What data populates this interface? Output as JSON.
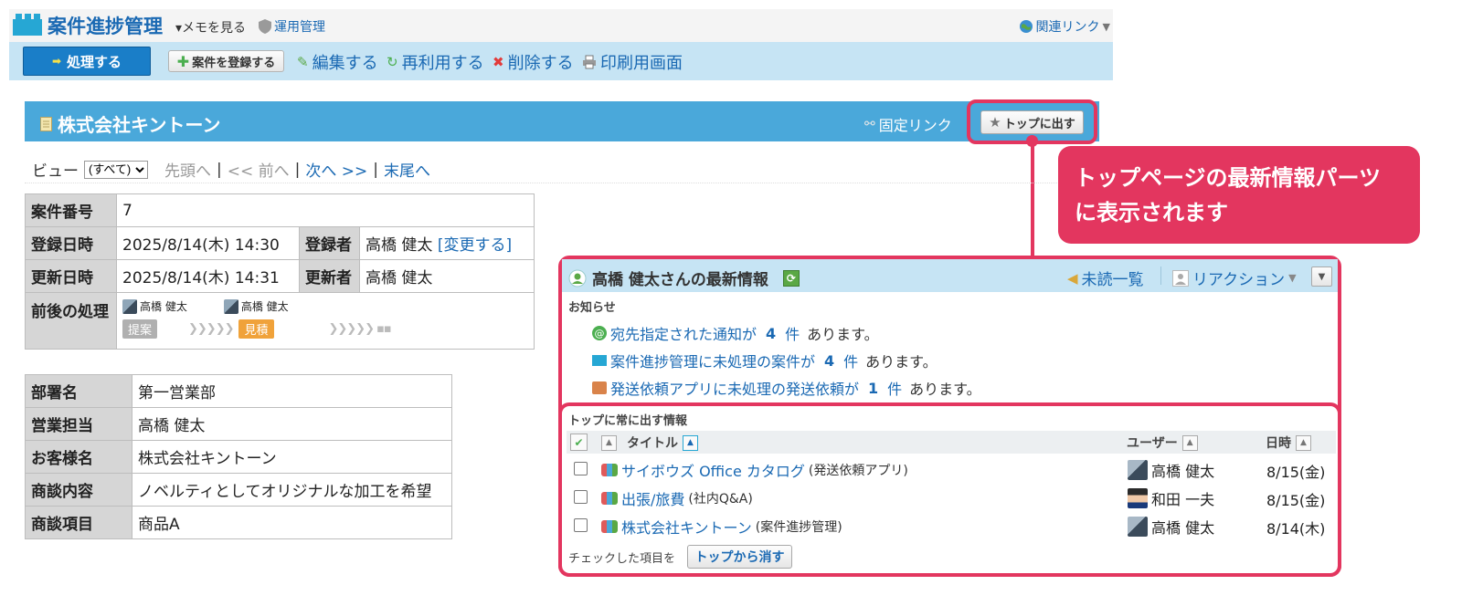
{
  "header": {
    "app_title": "案件進捗管理",
    "memo_label": "メモを見る",
    "admin_label": "運用管理",
    "related_label": "関連リンク"
  },
  "toolbar": {
    "process_label": "処理する",
    "register_label": "案件を登録する",
    "edit_label": "編集する",
    "reuse_label": "再利用する",
    "delete_label": "削除する",
    "print_label": "印刷用画面"
  },
  "record": {
    "title": "株式会社キントーン",
    "permalink_label": "固定リンク",
    "top_button_label": "トップに出す"
  },
  "nav": {
    "view_label": "ビュー",
    "view_selected": "(すべて)",
    "first_label": "先頭へ",
    "prev_label": "<< 前へ",
    "next_label": "次へ >>",
    "last_label": "末尾へ"
  },
  "details": {
    "case_no_label": "案件番号",
    "case_no_value": "7",
    "created_label": "登録日時",
    "created_value": "2025/8/14(木) 14:30",
    "creator_label": "登録者",
    "creator_value": "高橋 健太",
    "change_link": "[変更する]",
    "updated_label": "更新日時",
    "updated_value": "2025/8/14(木) 14:31",
    "updater_label": "更新者",
    "updater_value": "高橋 健太",
    "process_label": "前後の処理",
    "process_user1": "高橋 健太",
    "process_user2": "高橋 健太",
    "stage1": "提案",
    "stage2": "見積",
    "stage1_color": "#b0b0b0",
    "stage2_color": "#f0a23a"
  },
  "fields": [
    {
      "label": "部署名",
      "value": "第一営業部"
    },
    {
      "label": "営業担当",
      "value": "高橋 健太"
    },
    {
      "label": "お客様名",
      "value": "株式会社キントーン"
    },
    {
      "label": "商談内容",
      "value": "ノベルティとしてオリジナルな加工を希望"
    },
    {
      "label": "商談項目",
      "value": "商品A"
    }
  ],
  "callout": {
    "line1": "トップページの最新情報パーツ",
    "line2": "に表示されます",
    "color": "#e3365f"
  },
  "widget": {
    "title": "高橋 健太さんの最新情報",
    "unread_label": "未読一覧",
    "reaction_label": "リアクション",
    "notice_label": "お知らせ",
    "notices": [
      {
        "text": "宛先指定された通知が",
        "count": "4",
        "unit": "件",
        "tail": "あります。"
      },
      {
        "text": "案件進捗管理に未処理の案件が",
        "count": "4",
        "unit": "件",
        "tail": "あります。"
      },
      {
        "text": "発送依頼アプリに未処理の発送依頼が",
        "count": "1",
        "unit": "件",
        "tail": "あります。"
      }
    ],
    "pinned_label": "トップに常に出す情報",
    "columns": {
      "title": "タイトル",
      "user": "ユーザー",
      "date": "日時"
    },
    "rows": [
      {
        "title": "サイボウズ Office カタログ",
        "app": "(発送依頼アプリ)",
        "user": "高橋 健太",
        "date": "8/15(金)"
      },
      {
        "title": "出張/旅費",
        "app": "(社内Q&A)",
        "user": "和田 一夫",
        "date": "8/15(金)"
      },
      {
        "title": "株式会社キントーン",
        "app": "(案件進捗管理)",
        "user": "高橋 健太",
        "date": "8/14(木)"
      }
    ],
    "remove_prefix": "チェックした項目を",
    "remove_button": "トップから消す"
  }
}
